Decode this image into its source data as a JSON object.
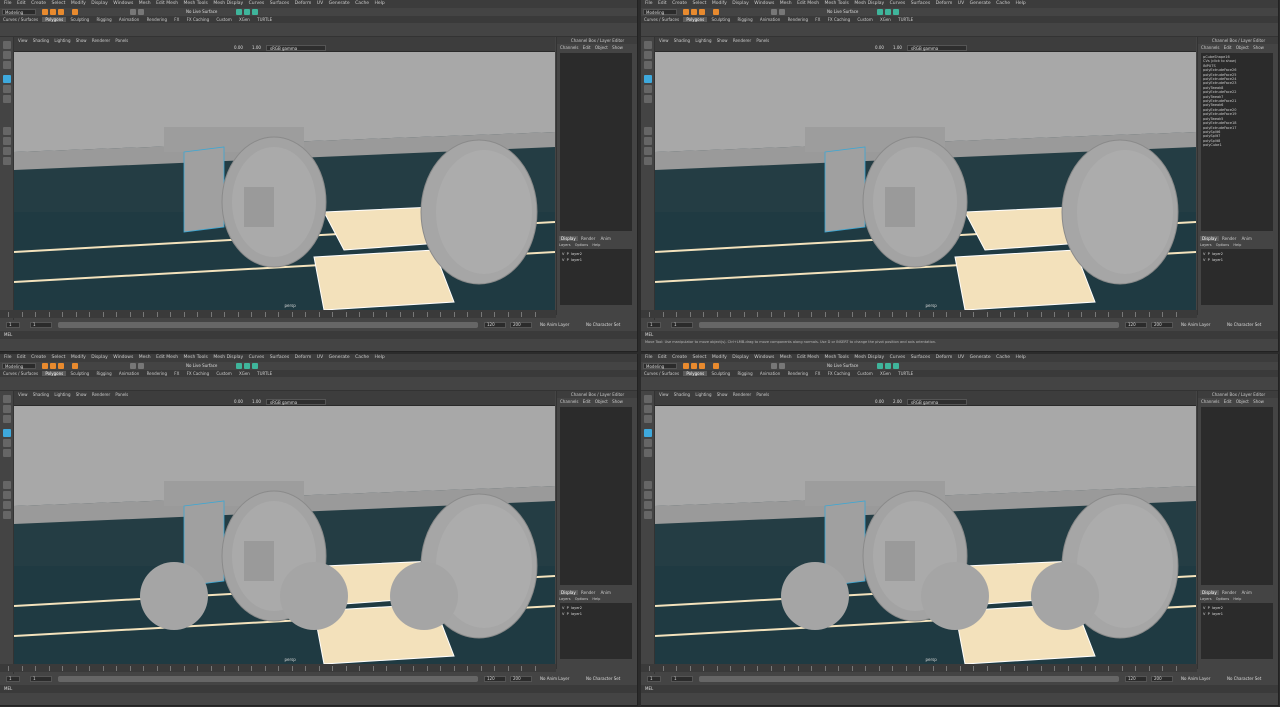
{
  "menu": [
    "File",
    "Edit",
    "Create",
    "Select",
    "Modify",
    "Display",
    "Windows",
    "Mesh",
    "Edit Mesh",
    "Mesh Tools",
    "Mesh Display",
    "Curves",
    "Surfaces",
    "Deform",
    "UV",
    "Generate",
    "Cache",
    "Help"
  ],
  "status": {
    "mode": "Modeling",
    "live_surface": "No Live Surface"
  },
  "shelf_tabs": [
    "Curves / Surfaces",
    "Polygons",
    "Sculpting",
    "Rigging",
    "Animation",
    "Rendering",
    "FX",
    "FX Caching",
    "Custom",
    "XGen",
    "TURTLE"
  ],
  "active_shelf_tab": "Polygons",
  "panel_menu": [
    "View",
    "Shading",
    "Lighting",
    "Show",
    "Renderer",
    "Panels"
  ],
  "viewport": {
    "gamma": "sRGB gamma",
    "camera": "persp",
    "exposure_values": [
      "0.00",
      "1.00"
    ],
    "exposure_values_alt": [
      "0.00",
      "2.00"
    ]
  },
  "channel_box": {
    "header": "Channel Box / Layer Editor",
    "menu": [
      "Channels",
      "Edit",
      "Object",
      "Show"
    ],
    "object": "pCubeShape16",
    "note": "CVs (click to show)",
    "inputs_label": "INPUTS",
    "history": [
      "polyExtrudeFace26",
      "polyExtrudeFace25",
      "polyExtrudeFace24",
      "polyExtrudeFace23",
      "polyTweak8",
      "polyExtrudeFace22",
      "polyTweak7",
      "polyExtrudeFace21",
      "polyTweak6",
      "polyExtrudeFace20",
      "polyExtrudeFace19",
      "polyTweak5",
      "polyExtrudeFace18",
      "polyExtrudeFace17",
      "polySplit6",
      "polySplit7",
      "polySplit8",
      "polyCube1"
    ]
  },
  "layer_editor": {
    "tabs": [
      "Display",
      "Render",
      "Anim"
    ],
    "active_tab": "Display",
    "menu": [
      "Layers",
      "Options",
      "Help"
    ],
    "layers": [
      {
        "v": "V",
        "p": "P",
        "name": "layer2"
      },
      {
        "v": "V",
        "p": "P",
        "name": "layer1"
      }
    ]
  },
  "time": {
    "start": "1",
    "current": "1",
    "current_frame": "120",
    "end": "120",
    "range_end": "200",
    "anim_layer": "No Anim Layer",
    "char_set": "No Character Set"
  },
  "command_line": {
    "lang": "MEL"
  },
  "help_line": "Move Tool: Use manipulator to move object(s). Ctrl+LMB-drag to move components along normals. Use D or INSERT to change the pivot position and axis orientation."
}
